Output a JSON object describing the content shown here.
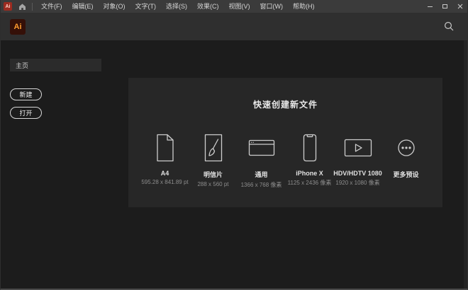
{
  "title_bar": {
    "app_badge_text": "Ai",
    "menus": [
      "文件(F)",
      "编辑(E)",
      "对象(O)",
      "文字(T)",
      "选择(S)",
      "效果(C)",
      "视图(V)",
      "窗口(W)",
      "帮助(H)"
    ]
  },
  "header": {
    "logo_text": "Ai"
  },
  "sidebar": {
    "home_tab": "主页",
    "new_button": "新建",
    "open_button": "打开"
  },
  "panel": {
    "title": "快速创建新文件",
    "cards": [
      {
        "name": "A4",
        "dims": "595.28 x 841.89 pt",
        "icon": "document-icon"
      },
      {
        "name": "明信片",
        "dims": "288 x 560 pt",
        "icon": "postcard-brush-icon"
      },
      {
        "name": "通用",
        "dims": "1366 x 768 像素",
        "icon": "browser-window-icon"
      },
      {
        "name": "iPhone X",
        "dims": "1125 x 2436 像素",
        "icon": "phone-icon"
      },
      {
        "name": "HDV/HDTV 1080",
        "dims": "1920 x 1080 像素",
        "icon": "video-play-icon"
      },
      {
        "name": "更多预设",
        "dims": "",
        "icon": "more-ellipsis-icon"
      }
    ]
  },
  "colors": {
    "titlebar_bg": "#3b3b3b",
    "header_bg": "#2f2f2f",
    "content_bg": "#1c1c1c",
    "panel_bg": "#272727",
    "logo_orange": "#ff9c2e",
    "logo_bg": "#351008",
    "taskbar_badge_red": "#9c2b20",
    "icon_stroke": "#cdcdcd"
  }
}
